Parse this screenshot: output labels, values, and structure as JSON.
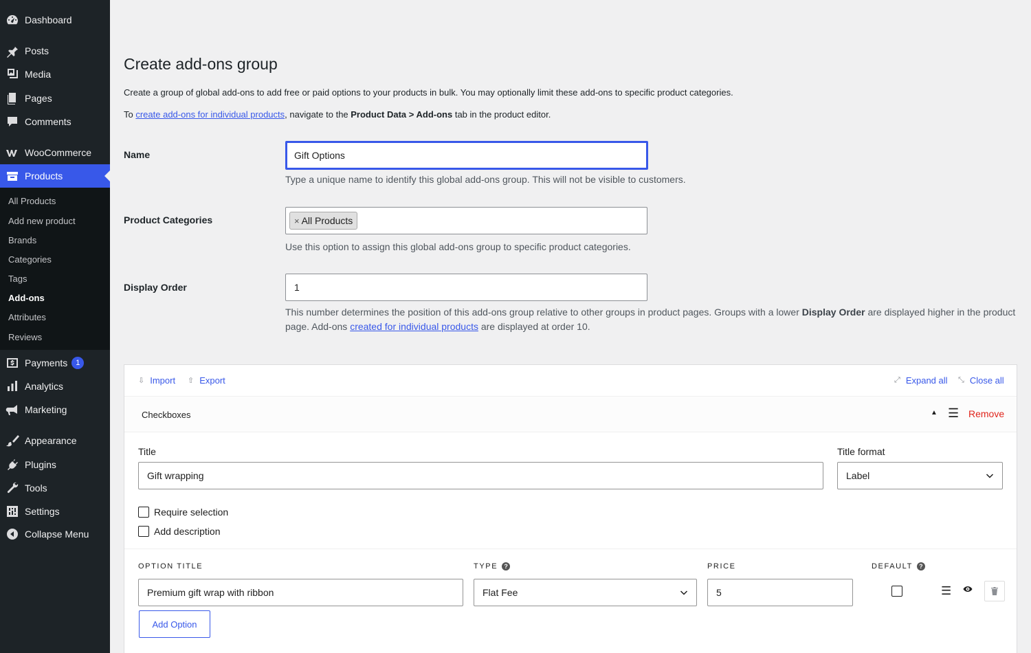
{
  "sidebar": {
    "menu": [
      {
        "label": "Dashboard",
        "icon": "dashboard-icon"
      },
      {
        "label": "Posts",
        "icon": "pin-icon"
      },
      {
        "label": "Media",
        "icon": "media-icon"
      },
      {
        "label": "Pages",
        "icon": "pages-icon"
      },
      {
        "label": "Comments",
        "icon": "comment-icon"
      },
      {
        "label": "WooCommerce",
        "icon": "woo-icon"
      },
      {
        "label": "Products",
        "icon": "archive-icon"
      },
      {
        "label": "Payments",
        "icon": "payments-icon",
        "badge": "1"
      },
      {
        "label": "Analytics",
        "icon": "chart-bar-icon"
      },
      {
        "label": "Marketing",
        "icon": "megaphone-icon"
      },
      {
        "label": "Appearance",
        "icon": "brush-icon"
      },
      {
        "label": "Plugins",
        "icon": "plug-icon"
      },
      {
        "label": "Tools",
        "icon": "wrench-icon"
      },
      {
        "label": "Settings",
        "icon": "settings-icon"
      },
      {
        "label": "Collapse Menu",
        "icon": "collapse-icon"
      }
    ],
    "submenu": [
      "All Products",
      "Add new product",
      "Brands",
      "Categories",
      "Tags",
      "Add-ons",
      "Attributes",
      "Reviews"
    ],
    "accent_color": "#3858e9"
  },
  "page": {
    "title": "Create add-ons group",
    "desc1": "Create a group of global add-ons to add free or paid options to your products in bulk. You may optionally limit these add-ons to specific product categories.",
    "desc2_prefix": "To ",
    "desc2_link": "create add-ons for individual products",
    "desc2_mid": ", navigate to the ",
    "desc2_bold": "Product Data > Add-ons",
    "desc2_suffix": " tab in the product editor."
  },
  "form": {
    "name_label": "Name",
    "name_value": "Gift Options",
    "name_hint": "Type a unique name to identify this global add-ons group. This will not be visible to customers.",
    "categories_label": "Product Categories",
    "categories_tag": "All Products",
    "categories_remove": "×",
    "categories_hint": "Use this option to assign this global add-ons group to specific product categories.",
    "order_label": "Display Order",
    "order_value": "1",
    "order_hint_1": "This number determines the position of this add-ons group relative to other groups in product pages. Groups with a lower ",
    "order_hint_bold": "Display Order",
    "order_hint_2": " are displayed higher in the product page. Add-ons ",
    "order_hint_link": "created for individual products",
    "order_hint_3": " are displayed at order 10."
  },
  "addons": {
    "import_label": "Import",
    "export_label": "Export",
    "expand_label": "Expand all",
    "close_label": "Close all",
    "type_label": "Checkboxes",
    "remove_label": "Remove",
    "title_label": "Title",
    "title_value": "Gift wrapping",
    "title_format_label": "Title format",
    "title_format_value": "Label",
    "require_label": "Require selection",
    "description_label": "Add description",
    "col_option_title": "OPTION TITLE",
    "col_type": "TYPE",
    "col_price": "PRICE",
    "col_default": "DEFAULT",
    "help_glyph": "?",
    "option_title_value": "Premium gift wrap with ribbon",
    "option_type_value": "Flat Fee",
    "option_price_value": "5",
    "add_option_label": "Add Option"
  }
}
